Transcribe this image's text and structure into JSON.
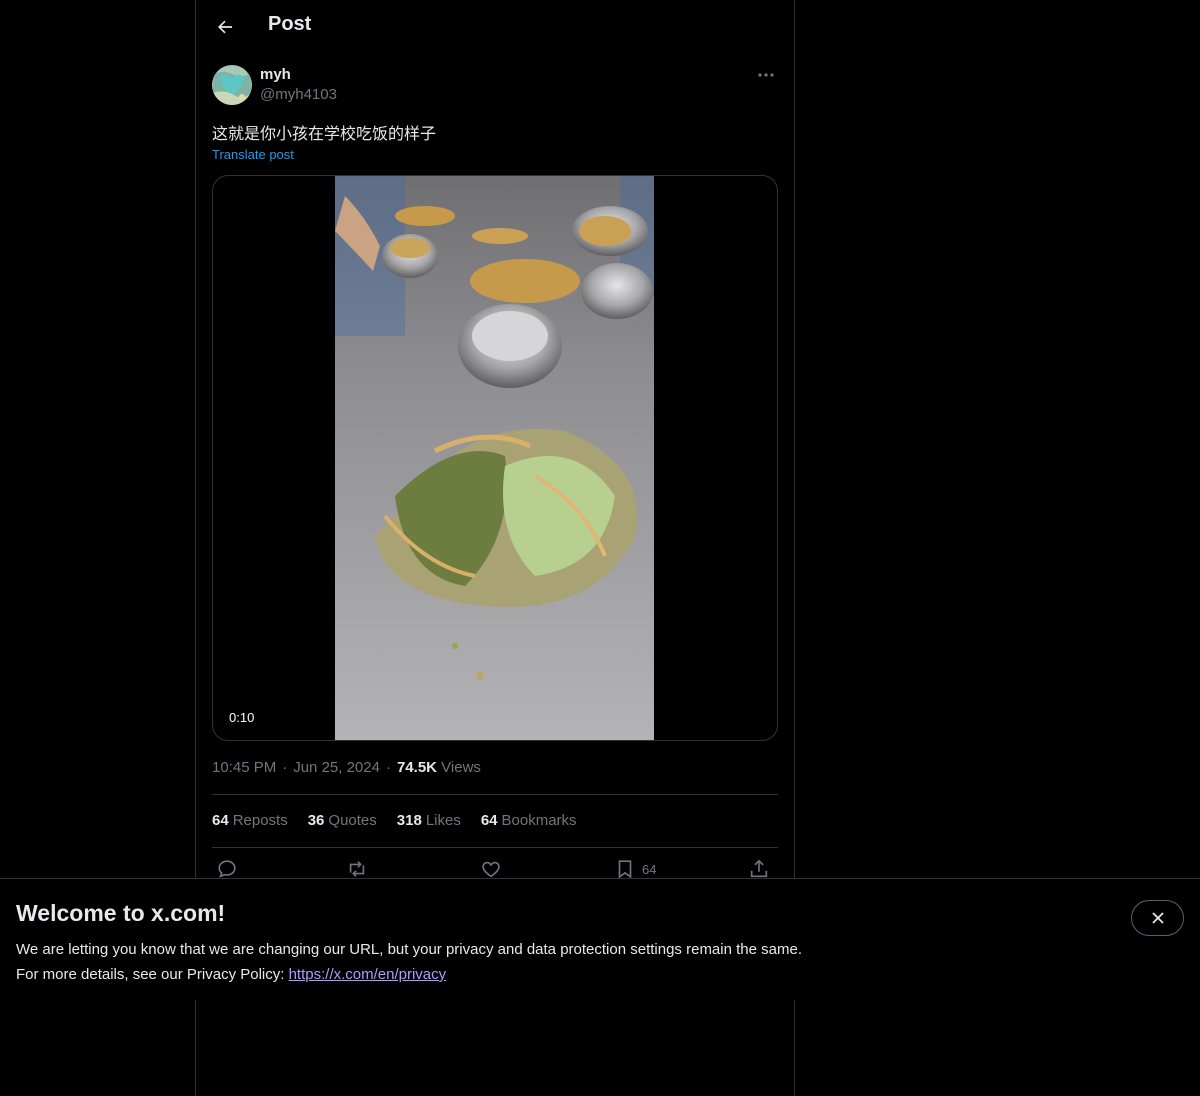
{
  "header": {
    "title": "Post"
  },
  "author": {
    "display_name": "myh",
    "handle": "@myh4103"
  },
  "post": {
    "text": "这就是你小孩在学校吃饭的样子",
    "translate_label": "Translate post",
    "video_duration": "0:10",
    "time": "10:45 PM",
    "date": "Jun 25, 2024",
    "views_count": "74.5K",
    "views_label": "Views",
    "separator": "·"
  },
  "stats": [
    {
      "count": "64",
      "label": "Reposts"
    },
    {
      "count": "36",
      "label": "Quotes"
    },
    {
      "count": "318",
      "label": "Likes"
    },
    {
      "count": "64",
      "label": "Bookmarks"
    }
  ],
  "actions": {
    "icons": [
      "reply-icon",
      "repost-icon",
      "like-icon",
      "bookmark-icon",
      "share-icon"
    ],
    "bookmark_count": "64"
  },
  "banner": {
    "title": "Welcome to x.com!",
    "line1": "We are letting you know that we are changing our URL, but your privacy and data protection settings remain the same.",
    "line2_prefix": "For more details, see our Privacy Policy: ",
    "link": "https://x.com/en/privacy"
  },
  "colors": {
    "accent": "#1d9bf0",
    "muted": "#71767b",
    "text": "#e7e9ea",
    "border": "#2f3336",
    "link": "#a3a1ff"
  }
}
